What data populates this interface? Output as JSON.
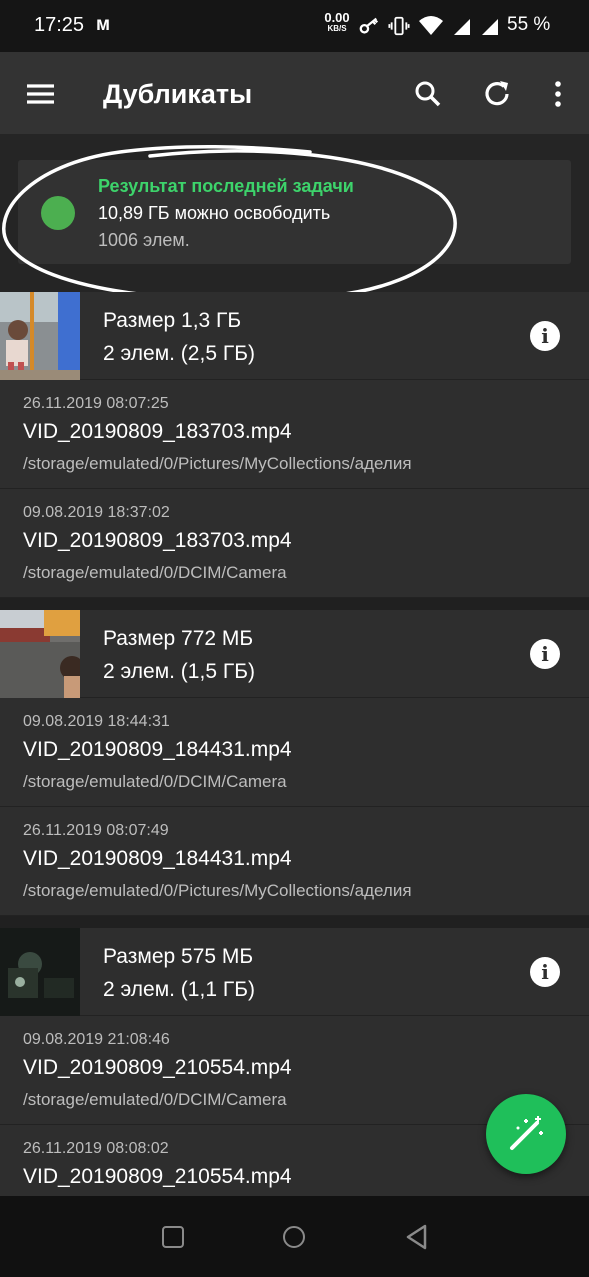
{
  "status_bar": {
    "time": "17:25",
    "app_letter": "м",
    "net_speed": "0.00",
    "net_unit": "KB/S",
    "battery": "55 %"
  },
  "app_bar": {
    "title": "Дубликаты",
    "icons": [
      "menu-icon",
      "search-icon",
      "refresh-icon",
      "more-vert-icon"
    ]
  },
  "summary": {
    "title": "Результат последней задачи",
    "main": "10,89 ГБ можно освободить",
    "sub": "1006 элем.",
    "accent_color": "#3dd36b"
  },
  "groups": [
    {
      "size": "Размер  1,3 ГБ",
      "count": "2 элем. (2,5 ГБ)",
      "files": [
        {
          "date": "26.11.2019 08:07:25",
          "name": "VID_20190809_183703.mp4",
          "path": "/storage/emulated/0/Pictures/MyCollections/аделия"
        },
        {
          "date": "09.08.2019 18:37:02",
          "name": "VID_20190809_183703.mp4",
          "path": "/storage/emulated/0/DCIM/Camera"
        }
      ]
    },
    {
      "size": "Размер  772 МБ",
      "count": "2 элем. (1,5 ГБ)",
      "files": [
        {
          "date": "09.08.2019 18:44:31",
          "name": "VID_20190809_184431.mp4",
          "path": "/storage/emulated/0/DCIM/Camera"
        },
        {
          "date": "26.11.2019 08:07:49",
          "name": "VID_20190809_184431.mp4",
          "path": "/storage/emulated/0/Pictures/MyCollections/аделия"
        }
      ]
    },
    {
      "size": "Размер  575 МБ",
      "count": "2 элем. (1,1 ГБ)",
      "files": [
        {
          "date": "09.08.2019 21:08:46",
          "name": "VID_20190809_210554.mp4",
          "path": "/storage/emulated/0/DCIM/Camera"
        },
        {
          "date": "26.11.2019 08:08:02",
          "name": "VID_20190809_210554.mp4",
          "path": ""
        }
      ]
    }
  ],
  "info_glyph": "i",
  "fab": {
    "icon": "magic-wand-icon",
    "color": "#1fbf5a"
  },
  "nav": {
    "icons": [
      "recents-square-icon",
      "home-circle-icon",
      "back-triangle-icon"
    ]
  }
}
